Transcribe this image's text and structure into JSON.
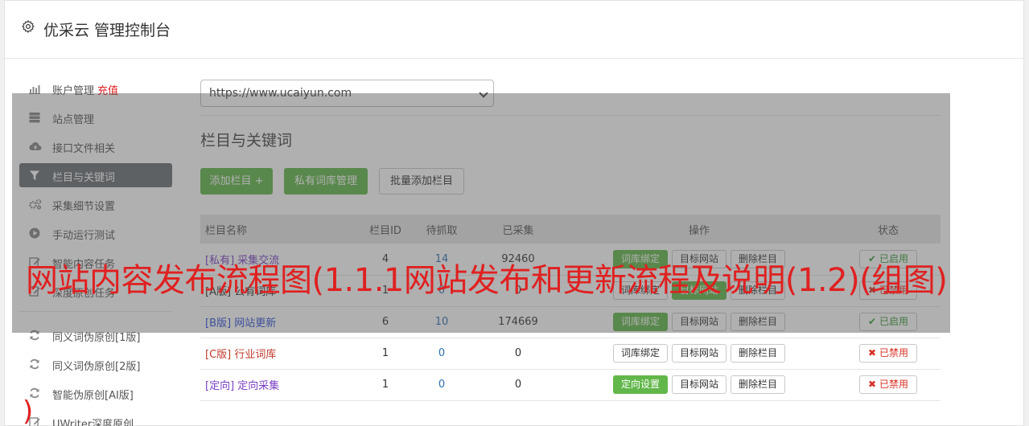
{
  "header": {
    "title": "优采云 管理控制台",
    "icon": "gear-icon"
  },
  "sidebar": {
    "items": [
      {
        "label": "账户管理",
        "extra": "充值",
        "icon": "bar-chart-icon"
      },
      {
        "label": "站点管理",
        "icon": "server-icon"
      },
      {
        "label": "接口文件相关",
        "icon": "cloud-upload-icon"
      },
      {
        "label": "栏目与关键词",
        "icon": "filter-icon",
        "active": true
      },
      {
        "label": "采集细节设置",
        "icon": "gears-icon"
      },
      {
        "label": "手动运行测试",
        "icon": "play-icon"
      },
      {
        "label": "智能内容任务",
        "icon": "edit-icon"
      },
      {
        "label": "深度原创任务",
        "icon": "edit-icon"
      }
    ],
    "items2": [
      {
        "label": "同义词伪原创[1版]",
        "icon": "refresh-icon"
      },
      {
        "label": "同义词伪原创[2版]",
        "icon": "refresh-icon"
      },
      {
        "label": "智能伪原创[AI版]",
        "icon": "refresh-icon"
      },
      {
        "label": "UWriter深度原创",
        "icon": "edit-icon"
      }
    ]
  },
  "main": {
    "site_select": "https://www.ucaiyun.com",
    "section_title": "栏目与关键词",
    "buttons": {
      "add": "添加栏目 +",
      "private": "私有词库管理",
      "batch": "批量添加栏目"
    },
    "table": {
      "headers": [
        "栏目名称",
        "栏目ID",
        "待抓取",
        "已采集",
        "操作",
        "状态"
      ],
      "rows": [
        {
          "tag": "[私有]",
          "name": "采集交流",
          "id": "4",
          "wait": "14",
          "done": "92460",
          "op1": "词库绑定",
          "op1_green": true,
          "op2": "目标网站",
          "op3": "删除栏目",
          "status": "已启用",
          "on": true
        },
        {
          "tag": "[A版]",
          "name": "公有词库",
          "id": "1",
          "wait": "0",
          "done": "0",
          "op1": "词库绑定",
          "op1_green": false,
          "op2": "目标网站",
          "op2_green": true,
          "op3": "删除栏目",
          "status": "已禁用",
          "on": false
        },
        {
          "tag": "[B版]",
          "name": "网站更新",
          "id": "6",
          "wait": "10",
          "done": "174669",
          "op1": "词库绑定",
          "op1_green": true,
          "op2": "目标网站",
          "op3": "删除栏目",
          "status": "已启用",
          "on": true
        },
        {
          "tag": "[C版]",
          "name": "行业词库",
          "id": "1",
          "wait": "0",
          "done": "0",
          "op1": "词库绑定",
          "op1_green": false,
          "op2": "目标网站",
          "op3": "删除栏目",
          "status": "已禁用",
          "on": false
        },
        {
          "tag": "[定向]",
          "name": "定向采集",
          "id": "1",
          "wait": "0",
          "done": "0",
          "op1": "定向设置",
          "op1_green": true,
          "op2": "目标网站",
          "op3": "删除栏目",
          "status": "已禁用",
          "on": false
        }
      ]
    }
  },
  "overlay_text": "网站内容发布流程图(1.1.1网站发布和更新流程及说明(1.2)(组图)",
  "overlay_paren": ")",
  "colors": {
    "green": "#62b74a",
    "red": "#e02020",
    "active_nav": "#6b6f76"
  }
}
